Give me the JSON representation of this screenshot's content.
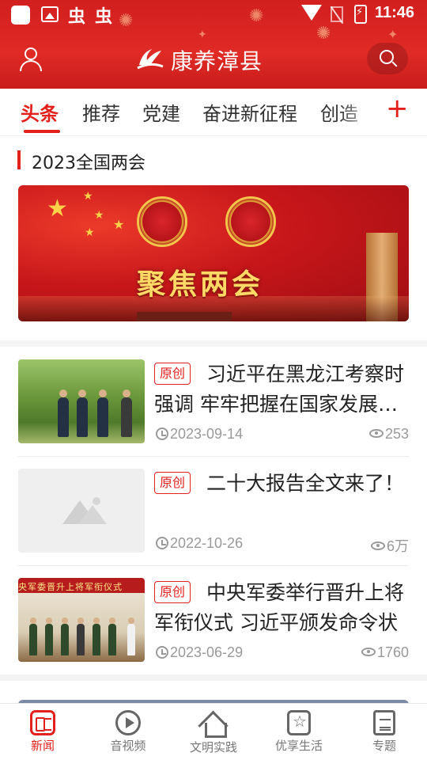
{
  "status_bar": {
    "time": "11:46",
    "notif_glyph_1": "虫",
    "notif_glyph_2": "虫"
  },
  "header": {
    "app_name": "康养漳县",
    "user_icon": "user-icon",
    "search_icon": "search-icon"
  },
  "tabs": [
    {
      "label": "头条",
      "active": true
    },
    {
      "label": "推荐"
    },
    {
      "label": "党建"
    },
    {
      "label": "奋进新征程"
    },
    {
      "label": "创造"
    }
  ],
  "tab_add_label": "+",
  "section": {
    "title": "2023全国两会",
    "banner_text": "聚焦两会"
  },
  "news": [
    {
      "badge": "原创",
      "title": "习近平在黑龙江考察时强调 牢牢把握在国家发展大局中的战略定位",
      "date": "2023-09-14",
      "views": "253",
      "thumb": "photo"
    },
    {
      "badge": "原创",
      "title": "二十大报告全文来了！",
      "date": "2022-10-26",
      "views": "6万",
      "thumb": "placeholder"
    },
    {
      "badge": "原创",
      "title": "中央军委举行晋升上将军衔仪式 习近平颁发命令状",
      "date": "2023-06-29",
      "views": "1760",
      "thumb": "photo",
      "thumb_caption": "央军委晋升上将军衔仪式"
    }
  ],
  "bottom_nav": [
    {
      "label": "新闻",
      "icon": "news-icon",
      "active": true
    },
    {
      "label": "音视频",
      "icon": "video-icon"
    },
    {
      "label": "文明实践",
      "icon": "home-icon"
    },
    {
      "label": "优享生活",
      "icon": "star-icon"
    },
    {
      "label": "专题",
      "icon": "topic-icon"
    }
  ],
  "colors": {
    "brand_red": "#e3201b",
    "header_red": "#d21f1f",
    "muted_text": "#999999"
  }
}
